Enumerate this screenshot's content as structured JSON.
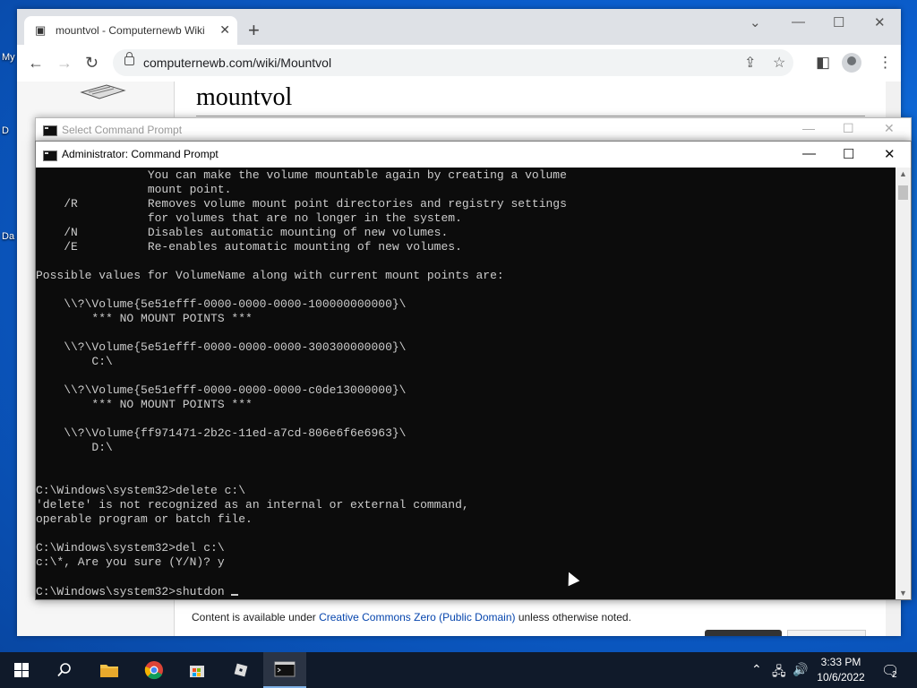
{
  "desktop": {
    "icon_labels": [
      "My",
      "D",
      "Da"
    ]
  },
  "browser": {
    "tab_title": "mountvol - Computernewb Wiki",
    "url": "computernewb.com/wiki/Mountvol",
    "page_title": "mountvol",
    "footer_prefix": "Content is available under ",
    "footer_link": "Creative Commons Zero (Public Domain)",
    "footer_suffix": " unless otherwise noted."
  },
  "cmd_back": {
    "title": "Select Command Prompt"
  },
  "cmd_front": {
    "title": "Administrator: Command Prompt",
    "lines": [
      "                You can make the volume mountable again by creating a volume",
      "                mount point.",
      "    /R          Removes volume mount point directories and registry settings",
      "                for volumes that are no longer in the system.",
      "    /N          Disables automatic mounting of new volumes.",
      "    /E          Re-enables automatic mounting of new volumes.",
      "",
      "Possible values for VolumeName along with current mount points are:",
      "",
      "    \\\\?\\Volume{5e51efff-0000-0000-0000-100000000000}\\",
      "        *** NO MOUNT POINTS ***",
      "",
      "    \\\\?\\Volume{5e51efff-0000-0000-0000-300300000000}\\",
      "        C:\\",
      "",
      "    \\\\?\\Volume{5e51efff-0000-0000-0000-c0de13000000}\\",
      "        *** NO MOUNT POINTS ***",
      "",
      "    \\\\?\\Volume{ff971471-2b2c-11ed-a7cd-806e6f6e6963}\\",
      "        D:\\",
      "",
      "",
      "C:\\Windows\\system32>delete c:\\",
      "'delete' is not recognized as an internal or external command,",
      "operable program or batch file.",
      "",
      "C:\\Windows\\system32>del c:\\",
      "c:\\*, Are you sure (Y/N)? y",
      ""
    ],
    "prompt_line": "C:\\Windows\\system32>shutdon "
  },
  "taskbar": {
    "time": "3:33 PM",
    "date": "10/6/2022",
    "notification_count": "2"
  }
}
